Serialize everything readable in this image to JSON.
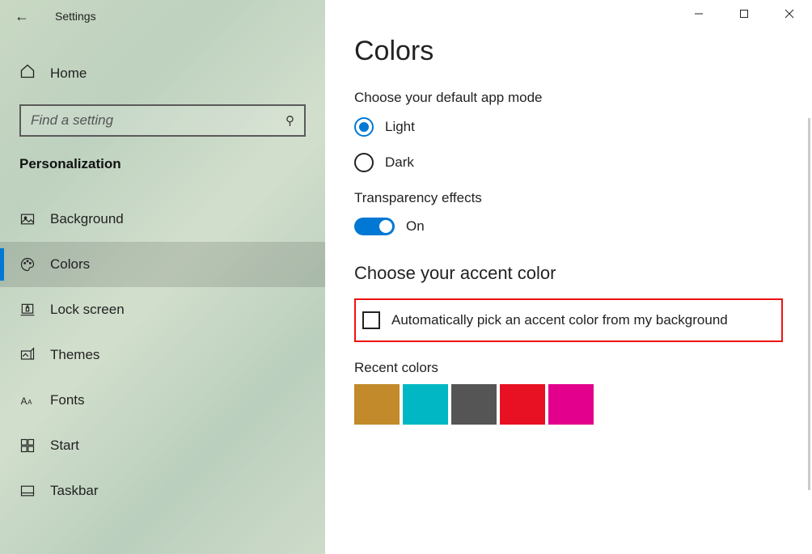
{
  "app_title": "Settings",
  "home_label": "Home",
  "search": {
    "placeholder": "Find a setting"
  },
  "category": "Personalization",
  "sidebar": {
    "items": [
      {
        "label": "Background"
      },
      {
        "label": "Colors"
      },
      {
        "label": "Lock screen"
      },
      {
        "label": "Themes"
      },
      {
        "label": "Fonts"
      },
      {
        "label": "Start"
      },
      {
        "label": "Taskbar"
      }
    ]
  },
  "main": {
    "title": "Colors",
    "appmode_label": "Choose your default app mode",
    "option_light": "Light",
    "option_dark": "Dark",
    "transparency_label": "Transparency effects",
    "transparency_state": "On",
    "accent_label": "Choose your accent color",
    "auto_accent_label": "Automatically pick an accent color from my background",
    "recent_label": "Recent colors",
    "recent_colors": [
      "#c28a2a",
      "#00b7c3",
      "#555555",
      "#e81123",
      "#e3008c"
    ]
  }
}
